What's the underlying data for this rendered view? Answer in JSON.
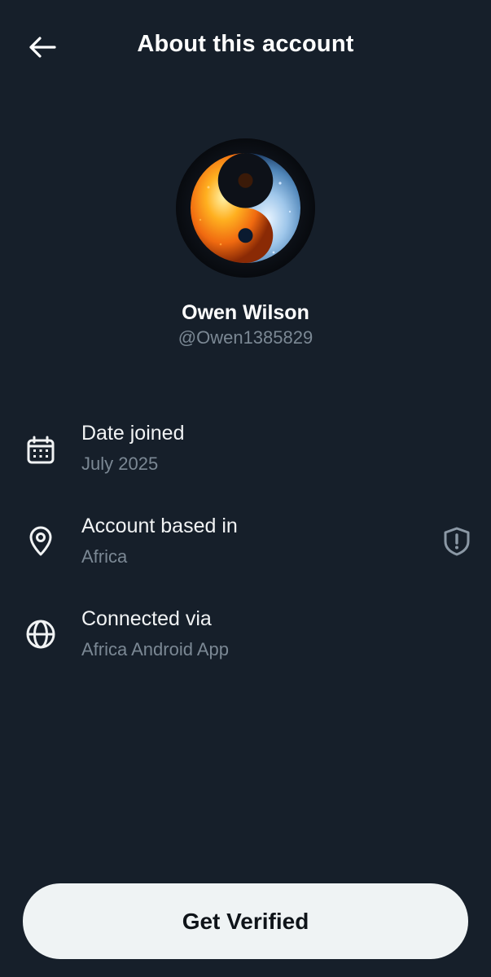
{
  "header": {
    "title": "About this account",
    "back_icon": "arrow-left-icon"
  },
  "profile": {
    "name": "Owen Wilson",
    "handle": "@Owen1385829",
    "avatar_icon": "yin-yang-fire-ice-avatar"
  },
  "details": {
    "date_joined": {
      "label": "Date joined",
      "value": "July 2025",
      "icon": "calendar-icon"
    },
    "account_based_in": {
      "label": "Account based in",
      "value": "Africa",
      "icon": "location-pin-icon",
      "info_icon": "shield-alert-icon"
    },
    "connected_via": {
      "label": "Connected via",
      "value": "Africa Android App",
      "icon": "globe-icon"
    }
  },
  "footer": {
    "verify_label": "Get Verified"
  },
  "colors": {
    "background": "#161f2a",
    "primary_text": "#ffffff",
    "secondary_text": "#7b8894",
    "button_bg": "#eff3f4",
    "button_text": "#0f1419"
  }
}
